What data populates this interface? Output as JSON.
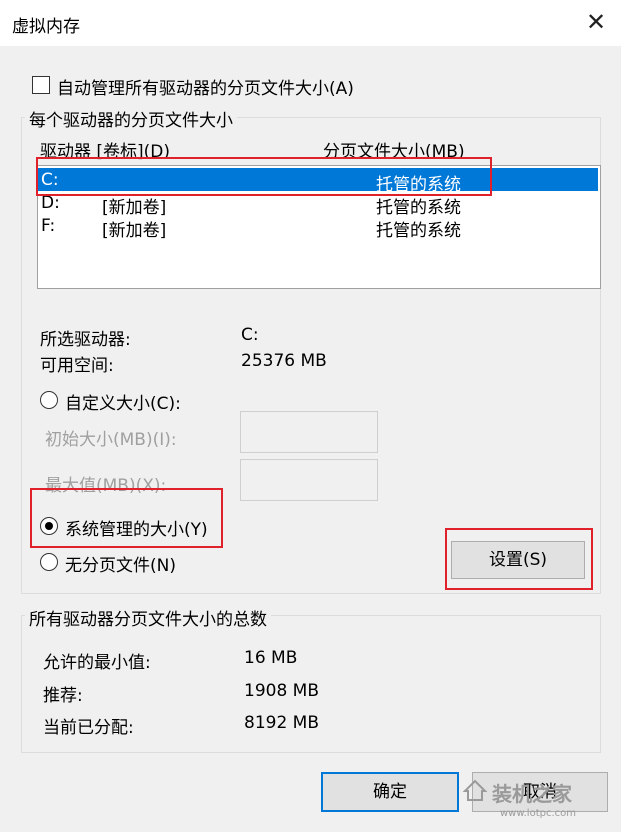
{
  "window": {
    "title": "虚拟内存",
    "close_glyph": "✕"
  },
  "auto_manage": {
    "label": "自动管理所有驱动器的分页文件大小(A)",
    "checked": false
  },
  "per_drive": {
    "group_label": "每个驱动器的分页文件大小",
    "header_drive": "驱动器 [卷标](D)",
    "header_size": "分页文件大小(MB)",
    "rows": [
      {
        "drive": "C:",
        "label": "",
        "size": "托管的系统",
        "selected": true
      },
      {
        "drive": "D:",
        "label": "[新加卷]",
        "size": "托管的系统",
        "selected": false
      },
      {
        "drive": "F:",
        "label": "[新加卷]",
        "size": "托管的系统",
        "selected": false
      }
    ],
    "selected_drive_label": "所选驱动器:",
    "selected_drive_value": "C:",
    "free_space_label": "可用空间:",
    "free_space_value": "25376 MB",
    "custom_size_label": "自定义大小(C):",
    "initial_size_label": "初始大小(MB)(I):",
    "max_size_label": "最大值(MB)(X):",
    "system_managed_label": "系统管理的大小(Y)",
    "no_paging_label": "无分页文件(N)",
    "set_button": "设置(S)"
  },
  "totals": {
    "group_label": "所有驱动器分页文件大小的总数",
    "min_label": "允许的最小值:",
    "min_value": "16 MB",
    "recommended_label": "推荐:",
    "recommended_value": "1908 MB",
    "allocated_label": "当前已分配:",
    "allocated_value": "8192 MB"
  },
  "buttons": {
    "ok": "确定",
    "cancel": "取消"
  },
  "watermark": {
    "text": "装机之家",
    "url": "www.lotpc.com"
  }
}
